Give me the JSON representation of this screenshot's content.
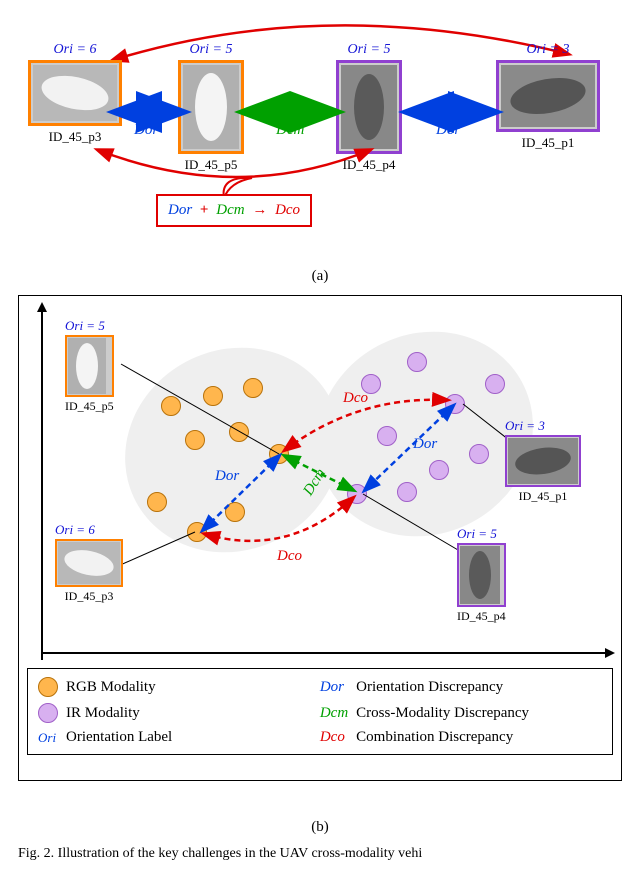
{
  "panelA": {
    "thumbs": {
      "t1": {
        "ori": "Ori = 6",
        "label": "ID_45_p3"
      },
      "t2": {
        "ori": "Ori = 5",
        "label": "ID_45_p5"
      },
      "t3": {
        "ori": "Ori = 5",
        "label": "ID_45_p4"
      },
      "t4": {
        "ori": "Ori = 3",
        "label": "ID_45_p1"
      }
    },
    "arrows": {
      "a1": "Dor",
      "a2": "Dcm",
      "a3": "Dor"
    },
    "formula": {
      "t1": "Dor",
      "plus": "+",
      "t2": "Dcm",
      "arrow": "→",
      "t3": "Dco"
    },
    "caption": "(a)"
  },
  "panelB": {
    "minis": {
      "m1": {
        "ori": "Ori = 5",
        "label": "ID_45_p5"
      },
      "m2": {
        "ori": "Ori = 6",
        "label": "ID_45_p3"
      },
      "m3": {
        "ori": "Ori = 3",
        "label": "ID_45_p1"
      },
      "m4": {
        "ori": "Ori = 5",
        "label": "ID_45_p4"
      }
    },
    "labels": {
      "dor1": "Dor",
      "dor2": "Dor",
      "dcm": "Dcm",
      "dco1": "Dco",
      "dco2": "Dco"
    },
    "legend": {
      "rgb": "RGB Modality",
      "ir": "IR Modality",
      "ori_sym": "Ori",
      "ori_txt": "Orientation Label",
      "dor_sym": "Dor",
      "dor_txt": "Orientation Discrepancy",
      "dcm_sym": "Dcm",
      "dcm_txt": "Cross-Modality Discrepancy",
      "dco_sym": "Dco",
      "dco_txt": "Combination Discrepancy"
    },
    "caption": "(b)"
  },
  "footnote": "Fig. 2.   Illustration of the key challenges in the UAV cross-modality vehi"
}
